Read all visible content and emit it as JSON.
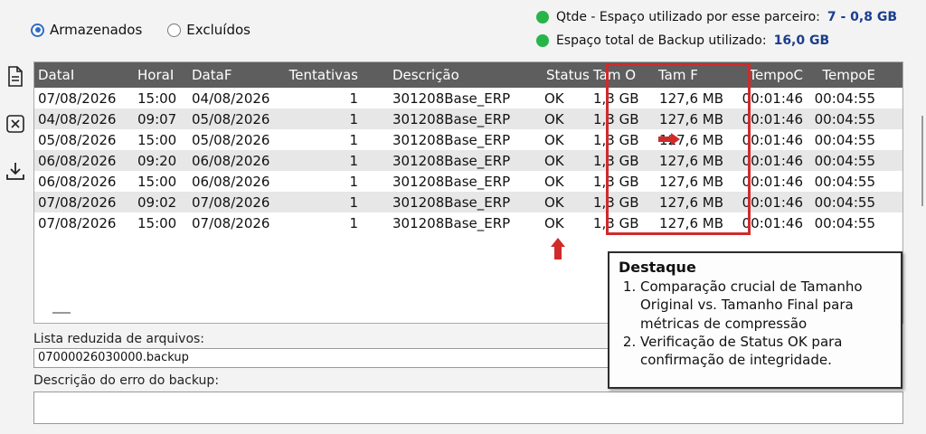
{
  "filter": {
    "options": [
      {
        "label": "Armazenados",
        "selected": true
      },
      {
        "label": "Excluídos",
        "selected": false
      }
    ]
  },
  "stats": [
    {
      "label": "Qtde - Espaço utilizado por esse parceiro:",
      "value": "7 - 0,8 GB",
      "color": "#27b54a"
    },
    {
      "label": "Espaço total de Backup utilizado:",
      "value": "16,0 GB",
      "color": "#27b54a"
    }
  ],
  "toolbar": {
    "icons": [
      "document-icon",
      "close-box-icon",
      "download-icon"
    ]
  },
  "grid": {
    "columns": [
      "DataI",
      "HoraI",
      "DataF",
      "Tentativas",
      "Descrição",
      "Status",
      "Tam O",
      "Tam F",
      "TempoC",
      "TempoE"
    ],
    "rows": [
      [
        "07/08/2026",
        "15:00",
        "04/08/2026",
        "1",
        "301208Base_ERP",
        "OK",
        "1,3 GB",
        "127,6 MB",
        "00:01:46",
        "00:04:55"
      ],
      [
        "04/08/2026",
        "09:07",
        "05/08/2026",
        "1",
        "301208Base_ERP",
        "OK",
        "1,3 GB",
        "127,6 MB",
        "00:01:46",
        "00:04:55"
      ],
      [
        "05/08/2026",
        "15:00",
        "05/08/2026",
        "1",
        "301208Base_ERP",
        "OK",
        "1,3 GB",
        "127,6 MB",
        "00:01:46",
        "00:04:55"
      ],
      [
        "06/08/2026",
        "09:20",
        "06/08/2026",
        "1",
        "301208Base_ERP",
        "OK",
        "1,3 GB",
        "127,6 MB",
        "00:01:46",
        "00:04:55"
      ],
      [
        "06/08/2026",
        "15:00",
        "06/08/2026",
        "1",
        "301208Base_ERP",
        "OK",
        "1,3 GB",
        "127,6 MB",
        "00:01:46",
        "00:04:55"
      ],
      [
        "07/08/2026",
        "09:02",
        "07/08/2026",
        "1",
        "301208Base_ERP",
        "OK",
        "1,3 GB",
        "127,6 MB",
        "00:01:46",
        "00:04:55"
      ],
      [
        "07/08/2026",
        "15:00",
        "07/08/2026",
        "1",
        "301208Base_ERP",
        "OK",
        "1,3 GB",
        "127,6 MB",
        "00:01:46",
        "00:04:55"
      ]
    ],
    "highlight_color": "#d12a2a"
  },
  "files": {
    "label": "Lista reduzida de arquivos:",
    "value": "07000026030000.backup"
  },
  "error": {
    "label": "Descrição do erro do backup:",
    "value": ""
  },
  "callout": {
    "title": "Destaque",
    "items": [
      "Comparação crucial de Tamanho Original vs. Tamanho Final para métricas de compressão",
      "Verificação de Status OK para confirmação de integridade."
    ]
  }
}
